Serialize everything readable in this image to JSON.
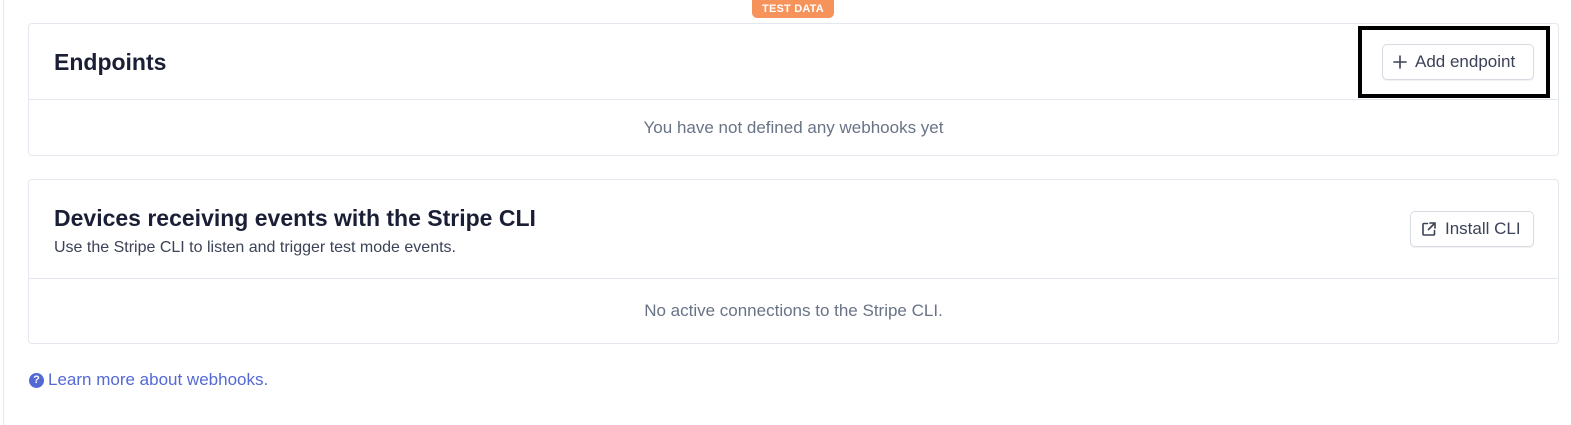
{
  "badge": {
    "label": "TEST DATA"
  },
  "endpoints": {
    "title": "Endpoints",
    "add_button_label": "Add endpoint",
    "empty_message": "You have not defined any webhooks yet"
  },
  "devices": {
    "title": "Devices receiving events with the Stripe CLI",
    "subtitle": "Use the Stripe CLI to listen and trigger test mode events.",
    "install_button_label": "Install CLI",
    "empty_message": "No active connections to the Stripe CLI."
  },
  "help": {
    "link_label": "Learn more about webhooks.",
    "icon_glyph": "?"
  },
  "icons": {
    "add": "plus-icon",
    "install": "external-link-icon",
    "help": "question-circle-icon"
  },
  "colors": {
    "badge": "#f5935a",
    "link": "#5469d4",
    "title": "#1a1f36",
    "muted": "#697386"
  }
}
